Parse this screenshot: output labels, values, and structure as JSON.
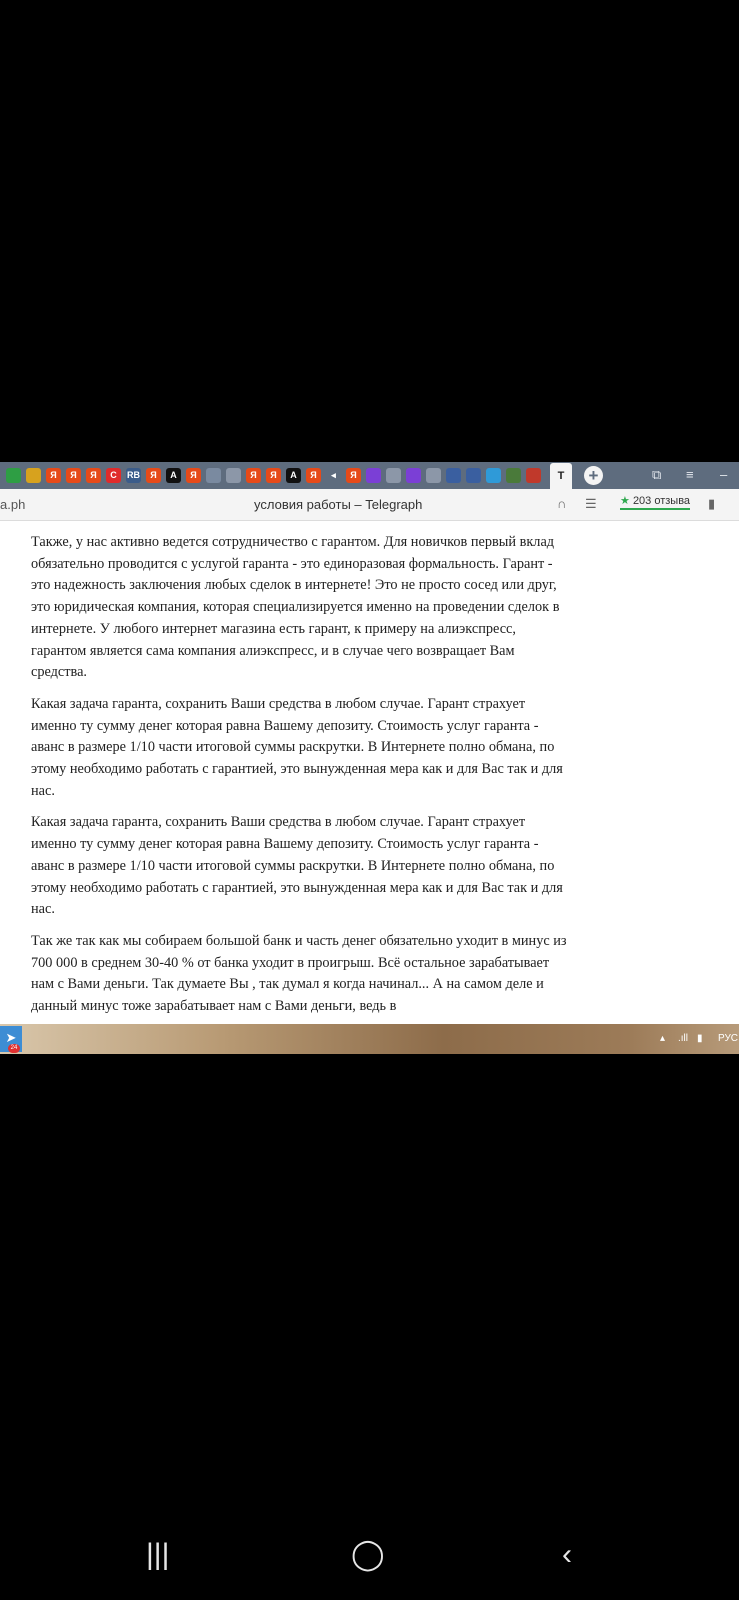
{
  "browser": {
    "tabs": [
      {
        "label": "",
        "color": "#2e9e44"
      },
      {
        "label": "",
        "color": "#d7a21e"
      },
      {
        "label": "Я",
        "color": "#e64a19"
      },
      {
        "label": "Я",
        "color": "#e64a19"
      },
      {
        "label": "Я",
        "color": "#e64a19"
      },
      {
        "label": "C",
        "color": "#e02b2b"
      },
      {
        "label": "RB",
        "color": "#3b5c8a"
      },
      {
        "label": "Я",
        "color": "#e64a19"
      },
      {
        "label": "A",
        "color": "#111111"
      },
      {
        "label": "Я",
        "color": "#e64a19"
      },
      {
        "label": "",
        "color": "#7a8aa0"
      },
      {
        "label": "",
        "color": "#8c97a8"
      },
      {
        "label": "Я",
        "color": "#e64a19"
      },
      {
        "label": "Я",
        "color": "#e64a19"
      },
      {
        "label": "A",
        "color": "#111111"
      },
      {
        "label": "Я",
        "color": "#e64a19"
      },
      {
        "label": "◂",
        "color": "#5e6c7e"
      },
      {
        "label": "Я",
        "color": "#e64a19"
      },
      {
        "label": "",
        "color": "#7b3fd6"
      },
      {
        "label": "",
        "color": "#8c97a8"
      },
      {
        "label": "",
        "color": "#7b3fd6"
      },
      {
        "label": "",
        "color": "#8c97a8"
      },
      {
        "label": "",
        "color": "#3a5fa0"
      },
      {
        "label": "",
        "color": "#3a5fa0"
      },
      {
        "label": "",
        "color": "#2f9ad8"
      },
      {
        "label": "",
        "color": "#4a7a3a"
      },
      {
        "label": "",
        "color": "#c0392b"
      }
    ],
    "active_tab_label": "T",
    "url_fragment": "a.ph",
    "page_title": "условия работы – Telegraph",
    "reviews_label": "203 отзыва"
  },
  "article": {
    "paragraphs": [
      "Также, у нас активно ведется сотрудничество с гарантом. Для новичков первый вклад обязательно проводится с услугой гаранта - это единоразовая формальность. Гарант - это надежность заключения любых сделок в интернете! Это не просто сосед или друг, это юридическая компания, которая специализируется именно на проведении сделок в интернете. У любого интернет магазина есть гарант, к примеру на алиэкспресс, гарантом является сама компания алиэкспресс, и в случае чего возвращает Вам средства.",
      "Какая задача гаранта, сохранить Ваши средства в любом случае. Гарант страхует именно ту сумму денег которая равна Вашему депозиту. Стоимость услуг гаранта - аванс в размере 1/10 части итоговой суммы раскрутки. В Интернете полно обмана, по этому необходимо работать с гарантией, это вынужденная мера как и для Вас так и для нас.",
      "Какая задача гаранта, сохранить Ваши средства в любом случае. Гарант страхует именно ту сумму денег которая равна Вашему депозиту. Стоимость услуг гаранта - аванс в размере 1/10 части итоговой суммы раскрутки. В Интернете полно обмана, по этому необходимо работать с гарантией, это вынужденная мера как и для Вас так и для нас.",
      "Так же так как мы собираем большой банк и часть денег обязательно уходит в минус из 700 000 в среднем 30-40 % от банка уходит в проигрыш. Всё остальное зарабатывает нам с Вами деньги. Так думаете Вы , так думал я когда начинал... А на самом деле и данный минус тоже зарабатывает нам с Вами деньги, ведь в"
    ]
  },
  "taskbar": {
    "telegram_badge": "24",
    "language": "РУС"
  }
}
